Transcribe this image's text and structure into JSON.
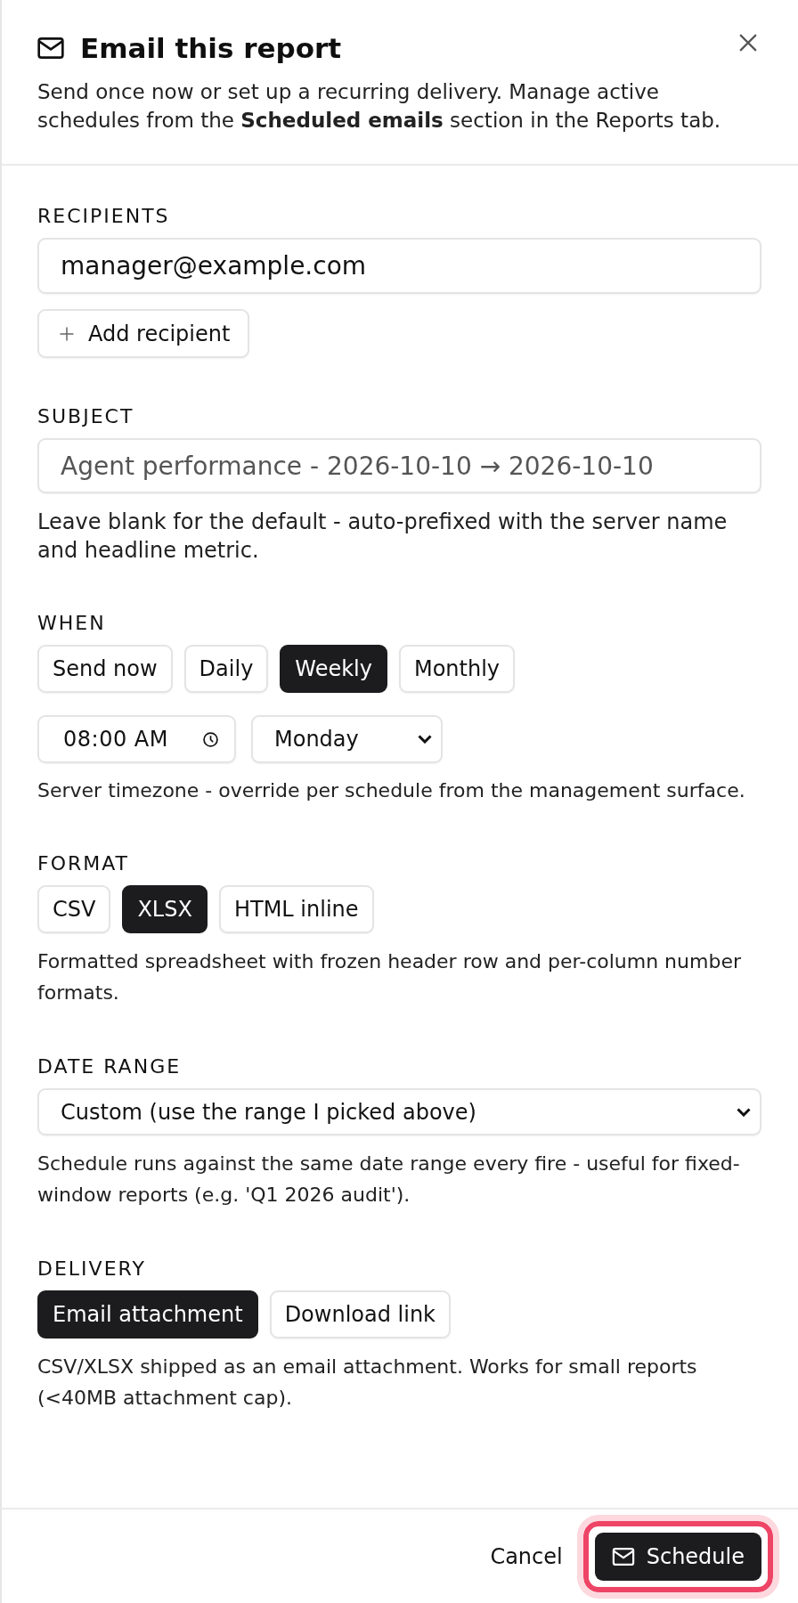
{
  "header": {
    "title": "Email this report",
    "description": "Send once now or set up a recurring delivery. Manage active schedules from the **Scheduled emails** section in the Reports tab."
  },
  "recipients": {
    "label": "RECIPIENTS",
    "value": "manager@example.com",
    "add_button": "Add recipient"
  },
  "subject": {
    "label": "SUBJECT",
    "placeholder": "Agent performance - 2026-10-10 → 2026-10-10",
    "hint": "Leave blank for the default - auto-prefixed with the server name and headline metric."
  },
  "when": {
    "label": "WHEN",
    "options": [
      {
        "label": "Send now",
        "selected": false
      },
      {
        "label": "Daily",
        "selected": false
      },
      {
        "label": "Weekly",
        "selected": true
      },
      {
        "label": "Monthly",
        "selected": false
      }
    ],
    "time": "08:00 AM",
    "day": "Monday",
    "hint": "Server timezone - override per schedule from the management surface."
  },
  "format": {
    "label": "FORMAT",
    "options": [
      {
        "label": "CSV",
        "selected": false
      },
      {
        "label": "XLSX",
        "selected": true
      },
      {
        "label": "HTML inline",
        "selected": false
      }
    ],
    "hint": "Formatted spreadsheet with frozen header row and per-column number formats."
  },
  "date_range": {
    "label": "DATE RANGE",
    "value": "Custom (use the range I picked above)",
    "hint": "Schedule runs against the same date range every fire - useful for fixed-window reports (e.g. 'Q1 2026 audit')."
  },
  "delivery": {
    "label": "DELIVERY",
    "options": [
      {
        "label": "Email attachment",
        "selected": true
      },
      {
        "label": "Download link",
        "selected": false
      }
    ],
    "hint": "CSV/XLSX shipped as an email attachment. Works for small reports (<40MB attachment cap)."
  },
  "footer": {
    "cancel": "Cancel",
    "submit": {
      "label": "Schedule",
      "focused": true
    }
  }
}
